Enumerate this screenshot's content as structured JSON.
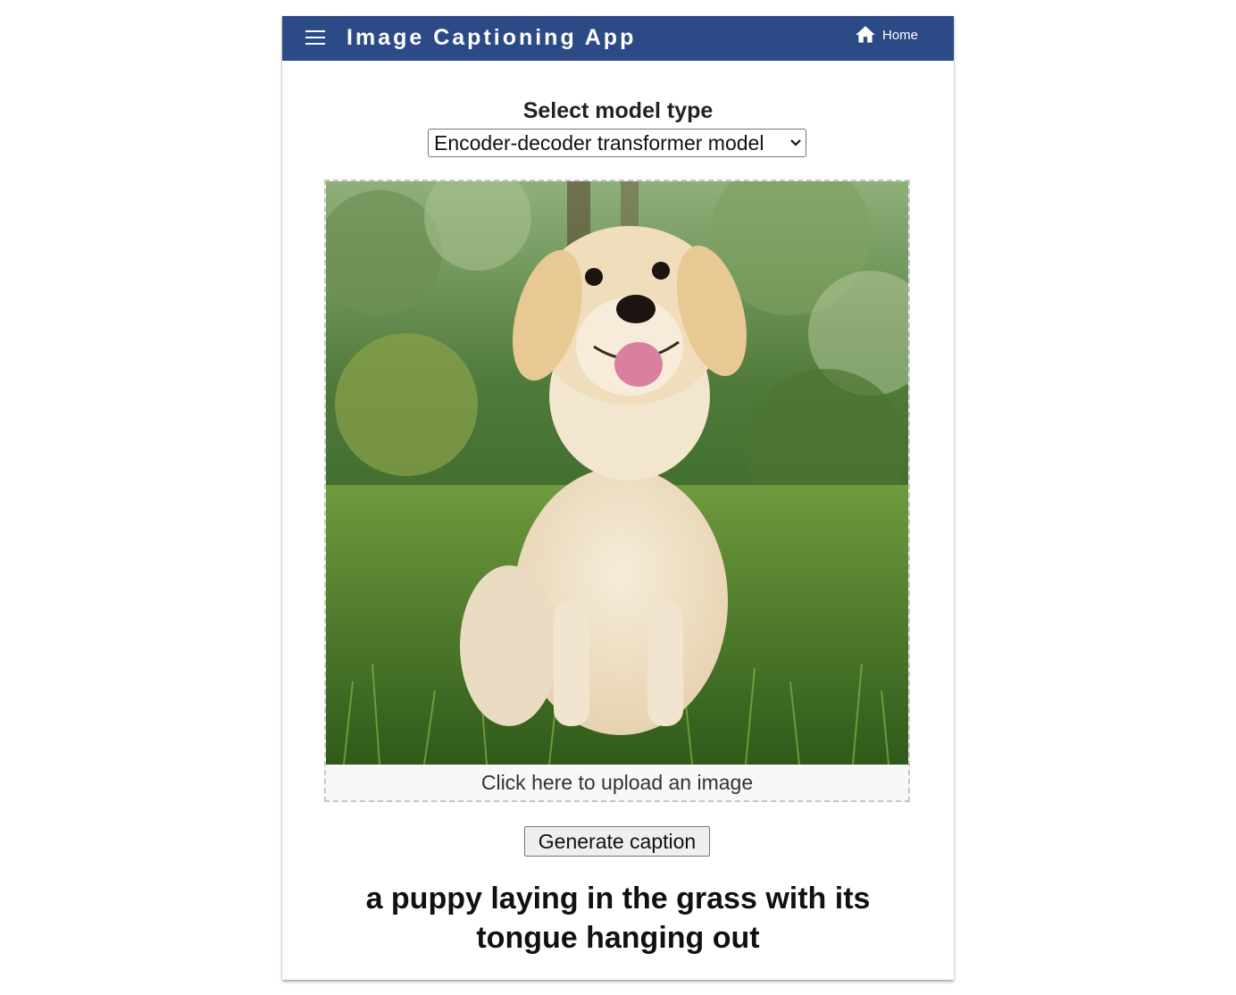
{
  "header": {
    "title": "Image Captioning App",
    "home_label": "Home",
    "background_color": "#2b4a86"
  },
  "model": {
    "label": "Select model type",
    "selected": "Encoder-decoder transformer model"
  },
  "upload": {
    "label": "Click here to upload an image"
  },
  "actions": {
    "generate_label": "Generate caption"
  },
  "result": {
    "caption": "a puppy laying in the grass with its tongue hanging out"
  },
  "icons": {
    "menu": "menu-icon",
    "home": "home-icon",
    "dropdown": "chevron-down-icon"
  }
}
